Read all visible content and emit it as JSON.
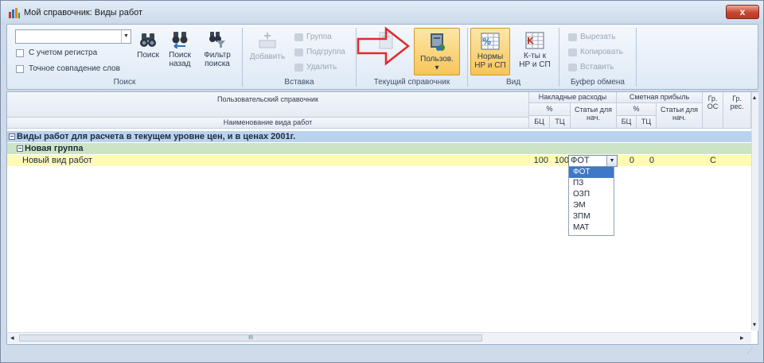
{
  "window": {
    "title": "Мой справочник: Виды работ",
    "close_label": "x"
  },
  "ribbon": {
    "search_group": {
      "caption": "Поиск",
      "search_value": "",
      "check_register": "С учетом регистра",
      "check_exact": "Точное совпадение слов",
      "search_label": "Поиск",
      "search_back_label_1": "Поиск",
      "search_back_label_2": "назад",
      "filter_label_1": "Фильтр",
      "filter_label_2": "поиска"
    },
    "insert_group": {
      "caption": "Вставка",
      "add_label": "Добавить",
      "group_label": "Группа",
      "subgroup_label": "Подгруппа",
      "delete_label": "Удалить"
    },
    "current_ref_group": {
      "caption": "Текущий справочник",
      "user_label": "Пользов.",
      "user_arrow": "▾"
    },
    "view_group": {
      "caption": "Вид",
      "norms_label_1": "Нормы",
      "norms_label_2": "НР и СП",
      "coef_label_1": "К-ты к",
      "coef_label_2": "НР и СП"
    },
    "clipboard_group": {
      "caption": "Буфер обмена",
      "cut_label": "Вырезать",
      "copy_label": "Копировать",
      "paste_label": "Вставить"
    }
  },
  "grid": {
    "headers": {
      "user_ref": "Пользовательский справочник",
      "work_name": "Наименование вида работ",
      "overhead": "Накладные расходы",
      "profit": "Сметная прибыль",
      "percent_1": "%",
      "percent_2": "%",
      "articles_1": "Статьи для нач.",
      "articles_2": "Статьи для нач.",
      "bc_1": "БЦ",
      "tc_1": "ТЦ",
      "bc_2": "БЦ",
      "tc_2": "ТЦ",
      "gr_os": "Гр. ОС",
      "gr_res": "Гр. рес."
    },
    "rows": {
      "band_1": "Виды работ для расчета в текущем уровне цен, и в ценах 2001г.",
      "band_2": "Новая группа",
      "item": {
        "name": "Новый вид работ",
        "bc_1": "100",
        "tc_1": "100",
        "articles_1": "ФОТ",
        "bc_2": "0",
        "tc_2": "0",
        "gr_os": "С"
      }
    },
    "dropdown_options": [
      "ФОТ",
      "ПЗ",
      "ОЗП",
      "ЭМ",
      "ЗПМ",
      "МАТ"
    ],
    "dropdown_selected": "ФОТ",
    "scroll_left": "◂",
    "scroll_right": "▸",
    "scroll_up": "▴",
    "scroll_down": "▾",
    "scroll_thumb_mark": "III"
  },
  "colors": {
    "band_1": "#b9d2ee",
    "band_2": "#cde3c6",
    "data_row": "#fffbb3",
    "selected_option": "#3e78c6",
    "arrow": "#e02b2b"
  }
}
